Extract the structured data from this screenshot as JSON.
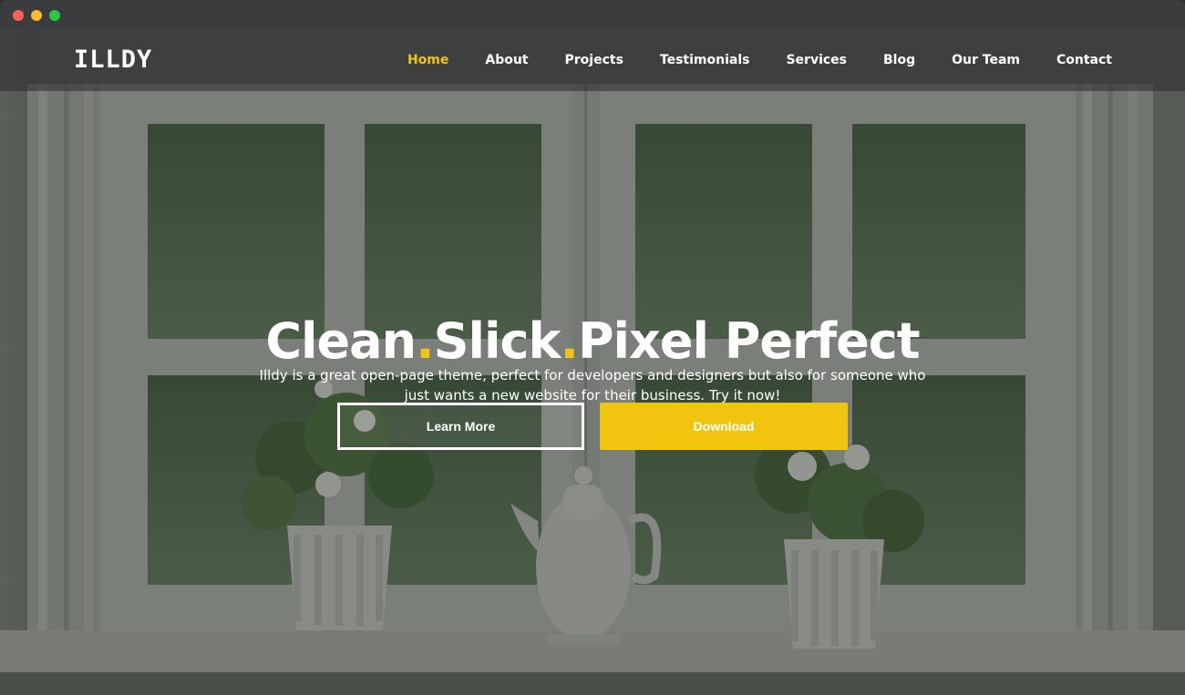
{
  "window": {
    "controls": [
      "close",
      "minimize",
      "maximize"
    ]
  },
  "header": {
    "logo": "ILLDY",
    "nav": [
      {
        "label": "Home",
        "active": true
      },
      {
        "label": "About",
        "active": false
      },
      {
        "label": "Projects",
        "active": false
      },
      {
        "label": "Testimonials",
        "active": false
      },
      {
        "label": "Services",
        "active": false
      },
      {
        "label": "Blog",
        "active": false
      },
      {
        "label": "Our Team",
        "active": false
      },
      {
        "label": "Contact",
        "active": false
      }
    ]
  },
  "hero": {
    "title_parts": [
      "Clean",
      ".",
      "Slick",
      ".",
      "Pixel Perfect"
    ],
    "description": "Illdy is a great open-page theme, perfect for developers and designers but also for someone who just wants a new website for their business. Try it now!",
    "buttons": {
      "learn_more": "Learn More",
      "download": "Download"
    },
    "background": "window-with-flower-vases-and-teapot"
  },
  "colors": {
    "accent": "#f1c40f",
    "text": "#ffffff",
    "header_overlay": "rgba(40,42,40,0.55)"
  }
}
